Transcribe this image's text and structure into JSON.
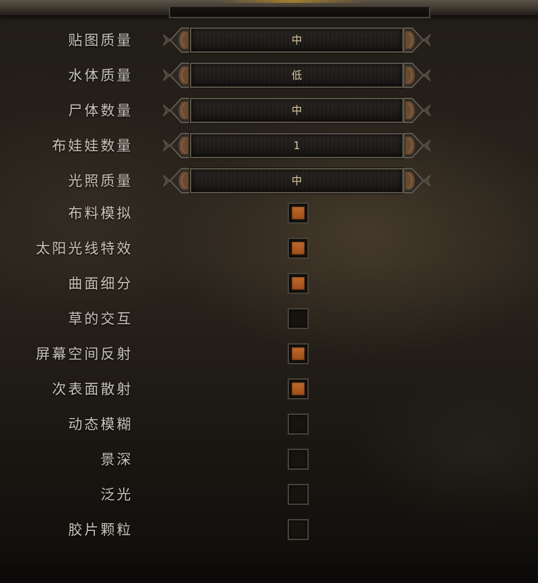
{
  "colors": {
    "checkbox_fill": "#b5602a",
    "label_text": "#c9c4ba",
    "value_text": "#d8c9a4",
    "frame": "#5a5347"
  },
  "selectors": [
    {
      "label": "贴图质量",
      "value": "中"
    },
    {
      "label": "水体质量",
      "value": "低"
    },
    {
      "label": "尸体数量",
      "value": "中"
    },
    {
      "label": "布娃娃数量",
      "value": "1"
    },
    {
      "label": "光照质量",
      "value": "中"
    }
  ],
  "toggles": [
    {
      "label": "布料模拟",
      "checked": true
    },
    {
      "label": "太阳光线特效",
      "checked": true
    },
    {
      "label": "曲面细分",
      "checked": true
    },
    {
      "label": "草的交互",
      "checked": false
    },
    {
      "label": "屏幕空间反射",
      "checked": true
    },
    {
      "label": "次表面散射",
      "checked": true
    },
    {
      "label": "动态模糊",
      "checked": false
    },
    {
      "label": "景深",
      "checked": false
    },
    {
      "label": "泛光",
      "checked": false
    },
    {
      "label": "胶片颗粒",
      "checked": false
    }
  ],
  "icons": {
    "left_arrow": "arrow-left-icon",
    "right_arrow": "arrow-right-icon"
  }
}
